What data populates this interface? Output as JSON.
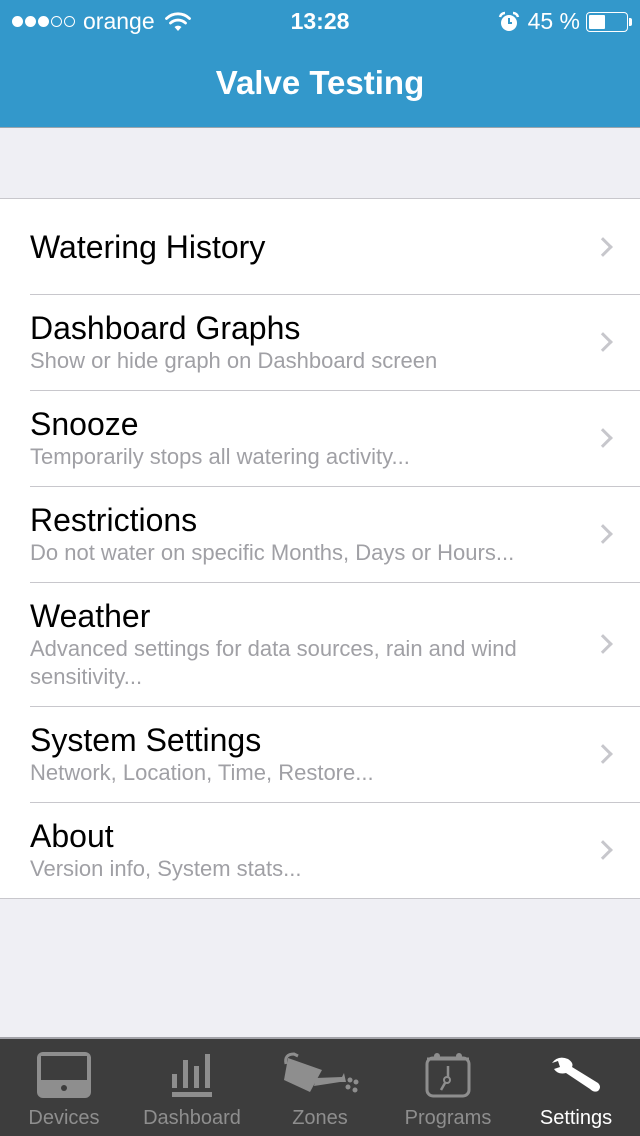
{
  "status_bar": {
    "signal_bars_filled": 3,
    "signal_bars_total": 5,
    "carrier": "orange",
    "wifi_icon": "wifi-icon",
    "time": "13:28",
    "alarm_icon": "alarm-icon",
    "battery_percent_label": "45 %",
    "battery_level": 0.45
  },
  "header": {
    "title": "Valve Testing"
  },
  "settings_list": [
    {
      "title": "Watering History",
      "subtitle": ""
    },
    {
      "title": "Dashboard Graphs",
      "subtitle": "Show or hide graph on Dashboard screen"
    },
    {
      "title": "Snooze",
      "subtitle": "Temporarily stops all watering activity..."
    },
    {
      "title": "Restrictions",
      "subtitle": "Do not water on specific Months, Days or Hours..."
    },
    {
      "title": "Weather",
      "subtitle": "Advanced settings for data sources, rain and wind sensitivity..."
    },
    {
      "title": "System Settings",
      "subtitle": "Network, Location, Time, Restore..."
    },
    {
      "title": "About",
      "subtitle": "Version info, System stats..."
    }
  ],
  "tab_bar": {
    "tabs": [
      {
        "label": "Devices",
        "icon": "device-icon",
        "active": false
      },
      {
        "label": "Dashboard",
        "icon": "bar-chart-icon",
        "active": false
      },
      {
        "label": "Zones",
        "icon": "watering-can-icon",
        "active": false
      },
      {
        "label": "Programs",
        "icon": "calendar-clock-icon",
        "active": false
      },
      {
        "label": "Settings",
        "icon": "wrench-icon",
        "active": true
      }
    ]
  },
  "colors": {
    "header_bg": "#3398cb",
    "tabbar_bg": "#3d3d3d",
    "tab_inactive": "#8e8e8e",
    "tab_active": "#ffffff",
    "subtitle_gray": "#a0a0a5"
  }
}
